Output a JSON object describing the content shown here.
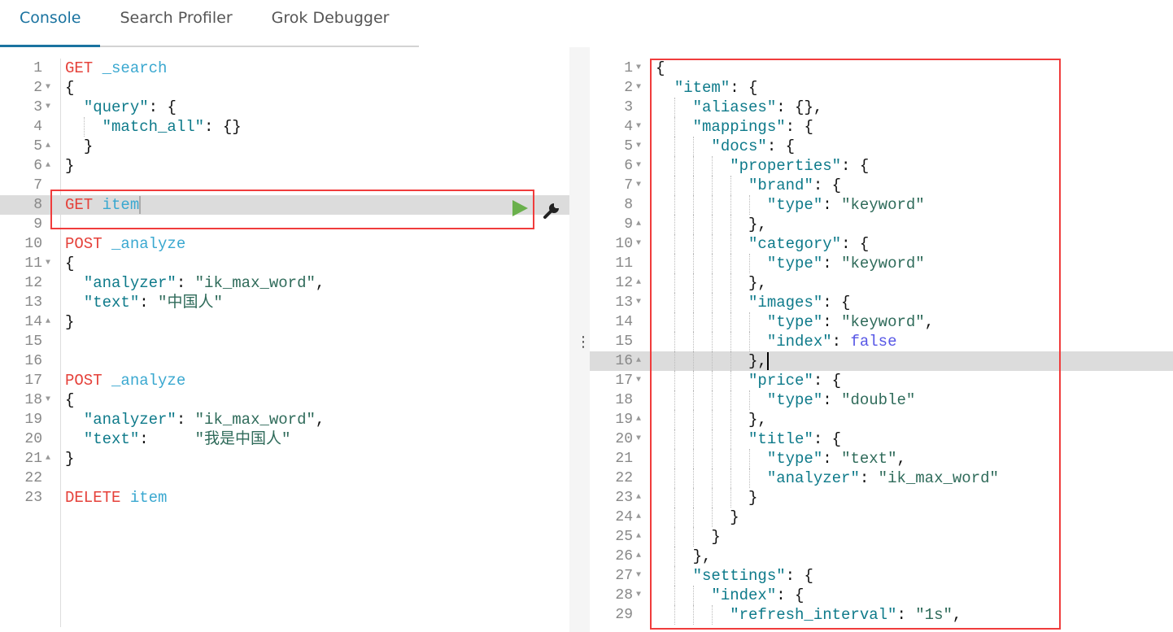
{
  "tabs": [
    {
      "label": "Console",
      "active": true
    },
    {
      "label": "Search Profiler",
      "active": false
    },
    {
      "label": "Grok Debugger",
      "active": false
    }
  ],
  "colors": {
    "method": "#e5413a",
    "path": "#3aa8d0",
    "key": "#0e7a8a",
    "string": "#2f6b5a",
    "bool": "#5757e6",
    "accent": "#1a73a0",
    "highlight_box": "#f03c3c",
    "run": "#6ab04c"
  },
  "divider_icon": "vertical-dots-icon",
  "request_editor": {
    "active_line": 8,
    "actions": {
      "run": "play-icon",
      "settings": "wrench-icon"
    },
    "lines": [
      {
        "n": "1",
        "text": "GET _search",
        "fold": ""
      },
      {
        "n": "2",
        "text": "{",
        "fold": "open"
      },
      {
        "n": "3",
        "text": "  \"query\": {",
        "fold": "open"
      },
      {
        "n": "4",
        "text": "    \"match_all\": {}",
        "fold": ""
      },
      {
        "n": "5",
        "text": "  }",
        "fold": "close"
      },
      {
        "n": "6",
        "text": "}",
        "fold": "close"
      },
      {
        "n": "7",
        "text": "",
        "fold": ""
      },
      {
        "n": "8",
        "text": "GET item",
        "fold": ""
      },
      {
        "n": "9",
        "text": "",
        "fold": ""
      },
      {
        "n": "10",
        "text": "POST _analyze",
        "fold": ""
      },
      {
        "n": "11",
        "text": "{",
        "fold": "open"
      },
      {
        "n": "12",
        "text": "  \"analyzer\": \"ik_max_word\",",
        "fold": ""
      },
      {
        "n": "13",
        "text": "  \"text\": \"中国人\"",
        "fold": ""
      },
      {
        "n": "14",
        "text": "}",
        "fold": "close"
      },
      {
        "n": "15",
        "text": "",
        "fold": ""
      },
      {
        "n": "16",
        "text": "",
        "fold": ""
      },
      {
        "n": "17",
        "text": "POST _analyze",
        "fold": ""
      },
      {
        "n": "18",
        "text": "{",
        "fold": "open"
      },
      {
        "n": "19",
        "text": "  \"analyzer\": \"ik_max_word\",",
        "fold": ""
      },
      {
        "n": "20",
        "text": "  \"text\":     \"我是中国人\"",
        "fold": ""
      },
      {
        "n": "21",
        "text": "}",
        "fold": "close"
      },
      {
        "n": "22",
        "text": "",
        "fold": ""
      },
      {
        "n": "23",
        "text": "DELETE item",
        "fold": ""
      }
    ]
  },
  "response_editor": {
    "active_line": 16,
    "lines": [
      {
        "n": "1",
        "text": "{",
        "fold": "open"
      },
      {
        "n": "2",
        "text": "  \"item\": {",
        "fold": "open"
      },
      {
        "n": "3",
        "text": "    \"aliases\": {},",
        "fold": ""
      },
      {
        "n": "4",
        "text": "    \"mappings\": {",
        "fold": "open"
      },
      {
        "n": "5",
        "text": "      \"docs\": {",
        "fold": "open"
      },
      {
        "n": "6",
        "text": "        \"properties\": {",
        "fold": "open"
      },
      {
        "n": "7",
        "text": "          \"brand\": {",
        "fold": "open"
      },
      {
        "n": "8",
        "text": "            \"type\": \"keyword\"",
        "fold": ""
      },
      {
        "n": "9",
        "text": "          },",
        "fold": "close"
      },
      {
        "n": "10",
        "text": "          \"category\": {",
        "fold": "open"
      },
      {
        "n": "11",
        "text": "            \"type\": \"keyword\"",
        "fold": ""
      },
      {
        "n": "12",
        "text": "          },",
        "fold": "close"
      },
      {
        "n": "13",
        "text": "          \"images\": {",
        "fold": "open"
      },
      {
        "n": "14",
        "text": "            \"type\": \"keyword\",",
        "fold": ""
      },
      {
        "n": "15",
        "text": "            \"index\": false",
        "fold": ""
      },
      {
        "n": "16",
        "text": "          },",
        "fold": "close"
      },
      {
        "n": "17",
        "text": "          \"price\": {",
        "fold": "open"
      },
      {
        "n": "18",
        "text": "            \"type\": \"double\"",
        "fold": ""
      },
      {
        "n": "19",
        "text": "          },",
        "fold": "close"
      },
      {
        "n": "20",
        "text": "          \"title\": {",
        "fold": "open"
      },
      {
        "n": "21",
        "text": "            \"type\": \"text\",",
        "fold": ""
      },
      {
        "n": "22",
        "text": "            \"analyzer\": \"ik_max_word\"",
        "fold": ""
      },
      {
        "n": "23",
        "text": "          }",
        "fold": "close"
      },
      {
        "n": "24",
        "text": "        }",
        "fold": "close"
      },
      {
        "n": "25",
        "text": "      }",
        "fold": "close"
      },
      {
        "n": "26",
        "text": "    },",
        "fold": "close"
      },
      {
        "n": "27",
        "text": "    \"settings\": {",
        "fold": "open"
      },
      {
        "n": "28",
        "text": "      \"index\": {",
        "fold": "open"
      },
      {
        "n": "29",
        "text": "        \"refresh_interval\": \"1s\",",
        "fold": ""
      }
    ]
  }
}
